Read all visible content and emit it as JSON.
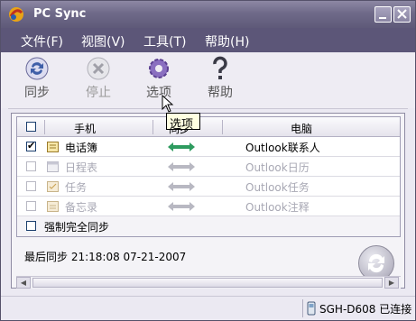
{
  "window": {
    "title": "PC Sync"
  },
  "menu": {
    "items": [
      {
        "label": "文件(F)"
      },
      {
        "label": "视图(V)"
      },
      {
        "label": "工具(T)"
      },
      {
        "label": "帮助(H)"
      }
    ]
  },
  "toolbar": {
    "tools": [
      {
        "label": "同步",
        "icon": "sync-icon",
        "enabled": true
      },
      {
        "label": "停止",
        "icon": "stop-icon",
        "enabled": false
      },
      {
        "label": "选项",
        "icon": "gear-icon",
        "enabled": true
      },
      {
        "label": "帮助",
        "icon": "help-icon",
        "enabled": true
      }
    ]
  },
  "grid": {
    "headers": {
      "phone": "手机",
      "sync": "同步",
      "pc": "电脑"
    },
    "rows": [
      {
        "name": "电话簿",
        "target": "Outlook联系人",
        "checked": true,
        "enabled": true
      },
      {
        "name": "日程表",
        "target": "Outlook日历",
        "checked": false,
        "enabled": false
      },
      {
        "name": "任务",
        "target": "Outlook任务",
        "checked": false,
        "enabled": false
      },
      {
        "name": "备忘录",
        "target": "Outlook注释",
        "checked": false,
        "enabled": false
      }
    ],
    "force_sync_label": "强制完全同步"
  },
  "last_sync": "最后同步 21:18:08 07-21-2007",
  "tooltip": "选项",
  "status": {
    "device": "SGH-D608 已连接"
  },
  "colors": {
    "titlebar": "#6f6a89",
    "menubar": "#5c5678",
    "arrow_active": "#2e9b5f",
    "arrow_inactive": "#b8b8c2"
  }
}
